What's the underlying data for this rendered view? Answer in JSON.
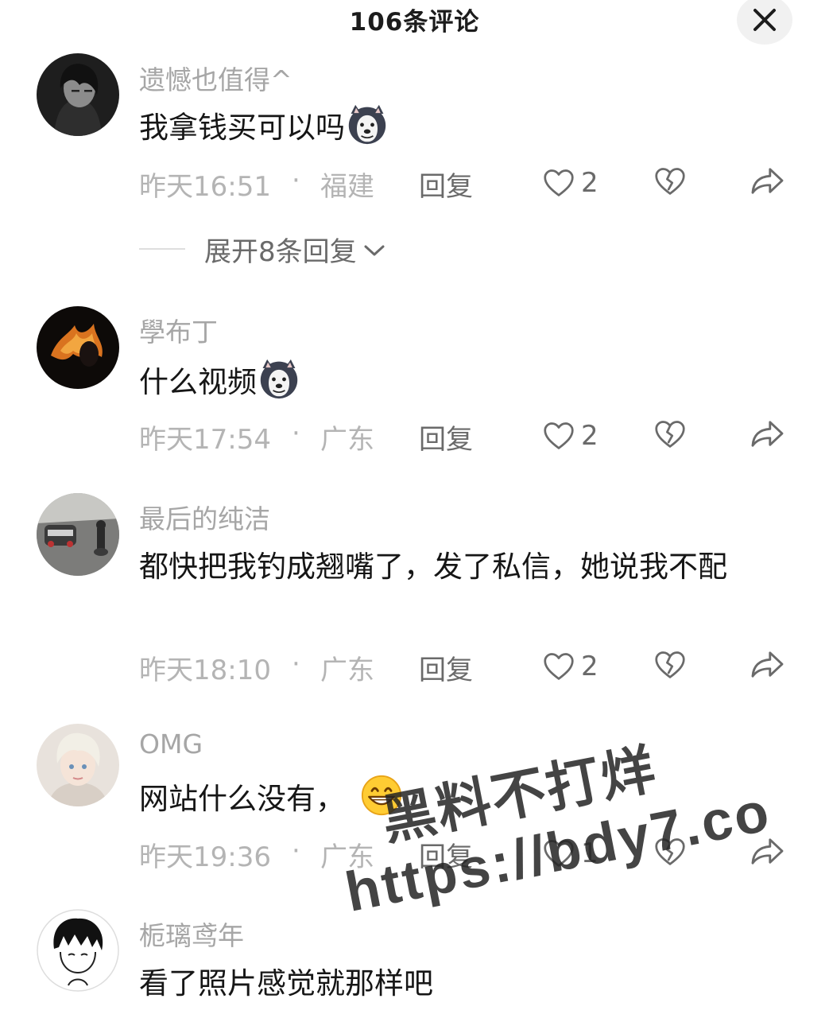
{
  "header": {
    "title": "106条评论",
    "close_icon": "close-icon"
  },
  "expand_replies": {
    "label": "展开8条回复"
  },
  "comments": [
    {
      "username": "遗憾也值得^",
      "text": "我拿钱买可以吗",
      "emoji": "husky-dog-emoji",
      "time": "昨天16:51",
      "dot": "·",
      "location": "福建",
      "reply": "回复",
      "likes": "2"
    },
    {
      "username": "學布丁",
      "text": "什么视频",
      "emoji": "husky-dog-emoji",
      "time": "昨天17:54",
      "dot": "·",
      "location": "广东",
      "reply": "回复",
      "likes": "2"
    },
    {
      "username": "最后的纯洁",
      "text": "都快把我钓成翘嘴了，发了私信，她说我不配",
      "time": "昨天18:10",
      "dot": "·",
      "location": "广东",
      "reply": "回复",
      "likes": "2"
    },
    {
      "username": "OMG",
      "text": "网站什么没有，",
      "emoji": "grinning-face-emoji",
      "time": "昨天19:36",
      "dot": "·",
      "location": "广东",
      "reply": "回复",
      "likes": "1"
    },
    {
      "username": "栀璃鸢年",
      "text": "看了照片感觉就那样吧"
    }
  ],
  "watermark": {
    "line1": "黑料不打烊",
    "line2": "https://bdy7.co"
  },
  "colors": {
    "text": "#161616",
    "muted": "#a6a6a6",
    "action": "#6a6a6a"
  }
}
